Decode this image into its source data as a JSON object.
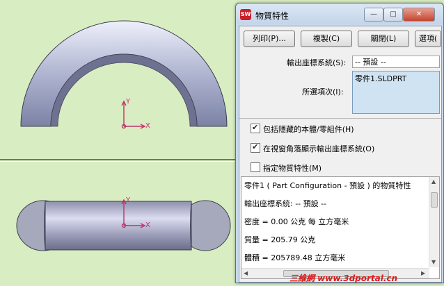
{
  "dialog": {
    "title": "物質特性",
    "app_icon": "SW",
    "window_buttons": {
      "minimize": "—",
      "maximize": "□",
      "close": "✕"
    },
    "buttons": {
      "print": "列印(P)...",
      "copy": "複製(C)",
      "close": "關閉(L)",
      "options": "選項("
    },
    "output_coord_label": "輸出座標系統(S):",
    "output_coord_value": "-- 預設 --",
    "selected_items_label": "所選項次(I):",
    "selected_item": "零件1.SLDPRT",
    "checkboxes": [
      {
        "label": "包括隱藏的本體/零組件(H)",
        "checked": true
      },
      {
        "label": "在視窗角落顯示輸出座標系統(O)",
        "checked": true
      },
      {
        "label": "指定物質特性(M)",
        "checked": false
      }
    ],
    "results": [
      "零件1 ( Part Configuration - 預設 ) 的物質特性",
      "輸出座標系統: -- 預設 --",
      "密度 = 0.00 公克 每  立方毫米",
      "質量 = 205.79 公克",
      "體積 = 205789.48  立方毫米"
    ]
  },
  "viewport": {
    "top_axis": {
      "y": "Y",
      "x": "X"
    },
    "bottom_axis": {
      "y": "Y",
      "x": "X"
    }
  },
  "watermark": "三維網 www.3dportal.cn",
  "colors": {
    "background": "#d9edc2",
    "axis": "#c0306a",
    "part": "#b7bdd6",
    "selection": "#cfe3f3"
  }
}
